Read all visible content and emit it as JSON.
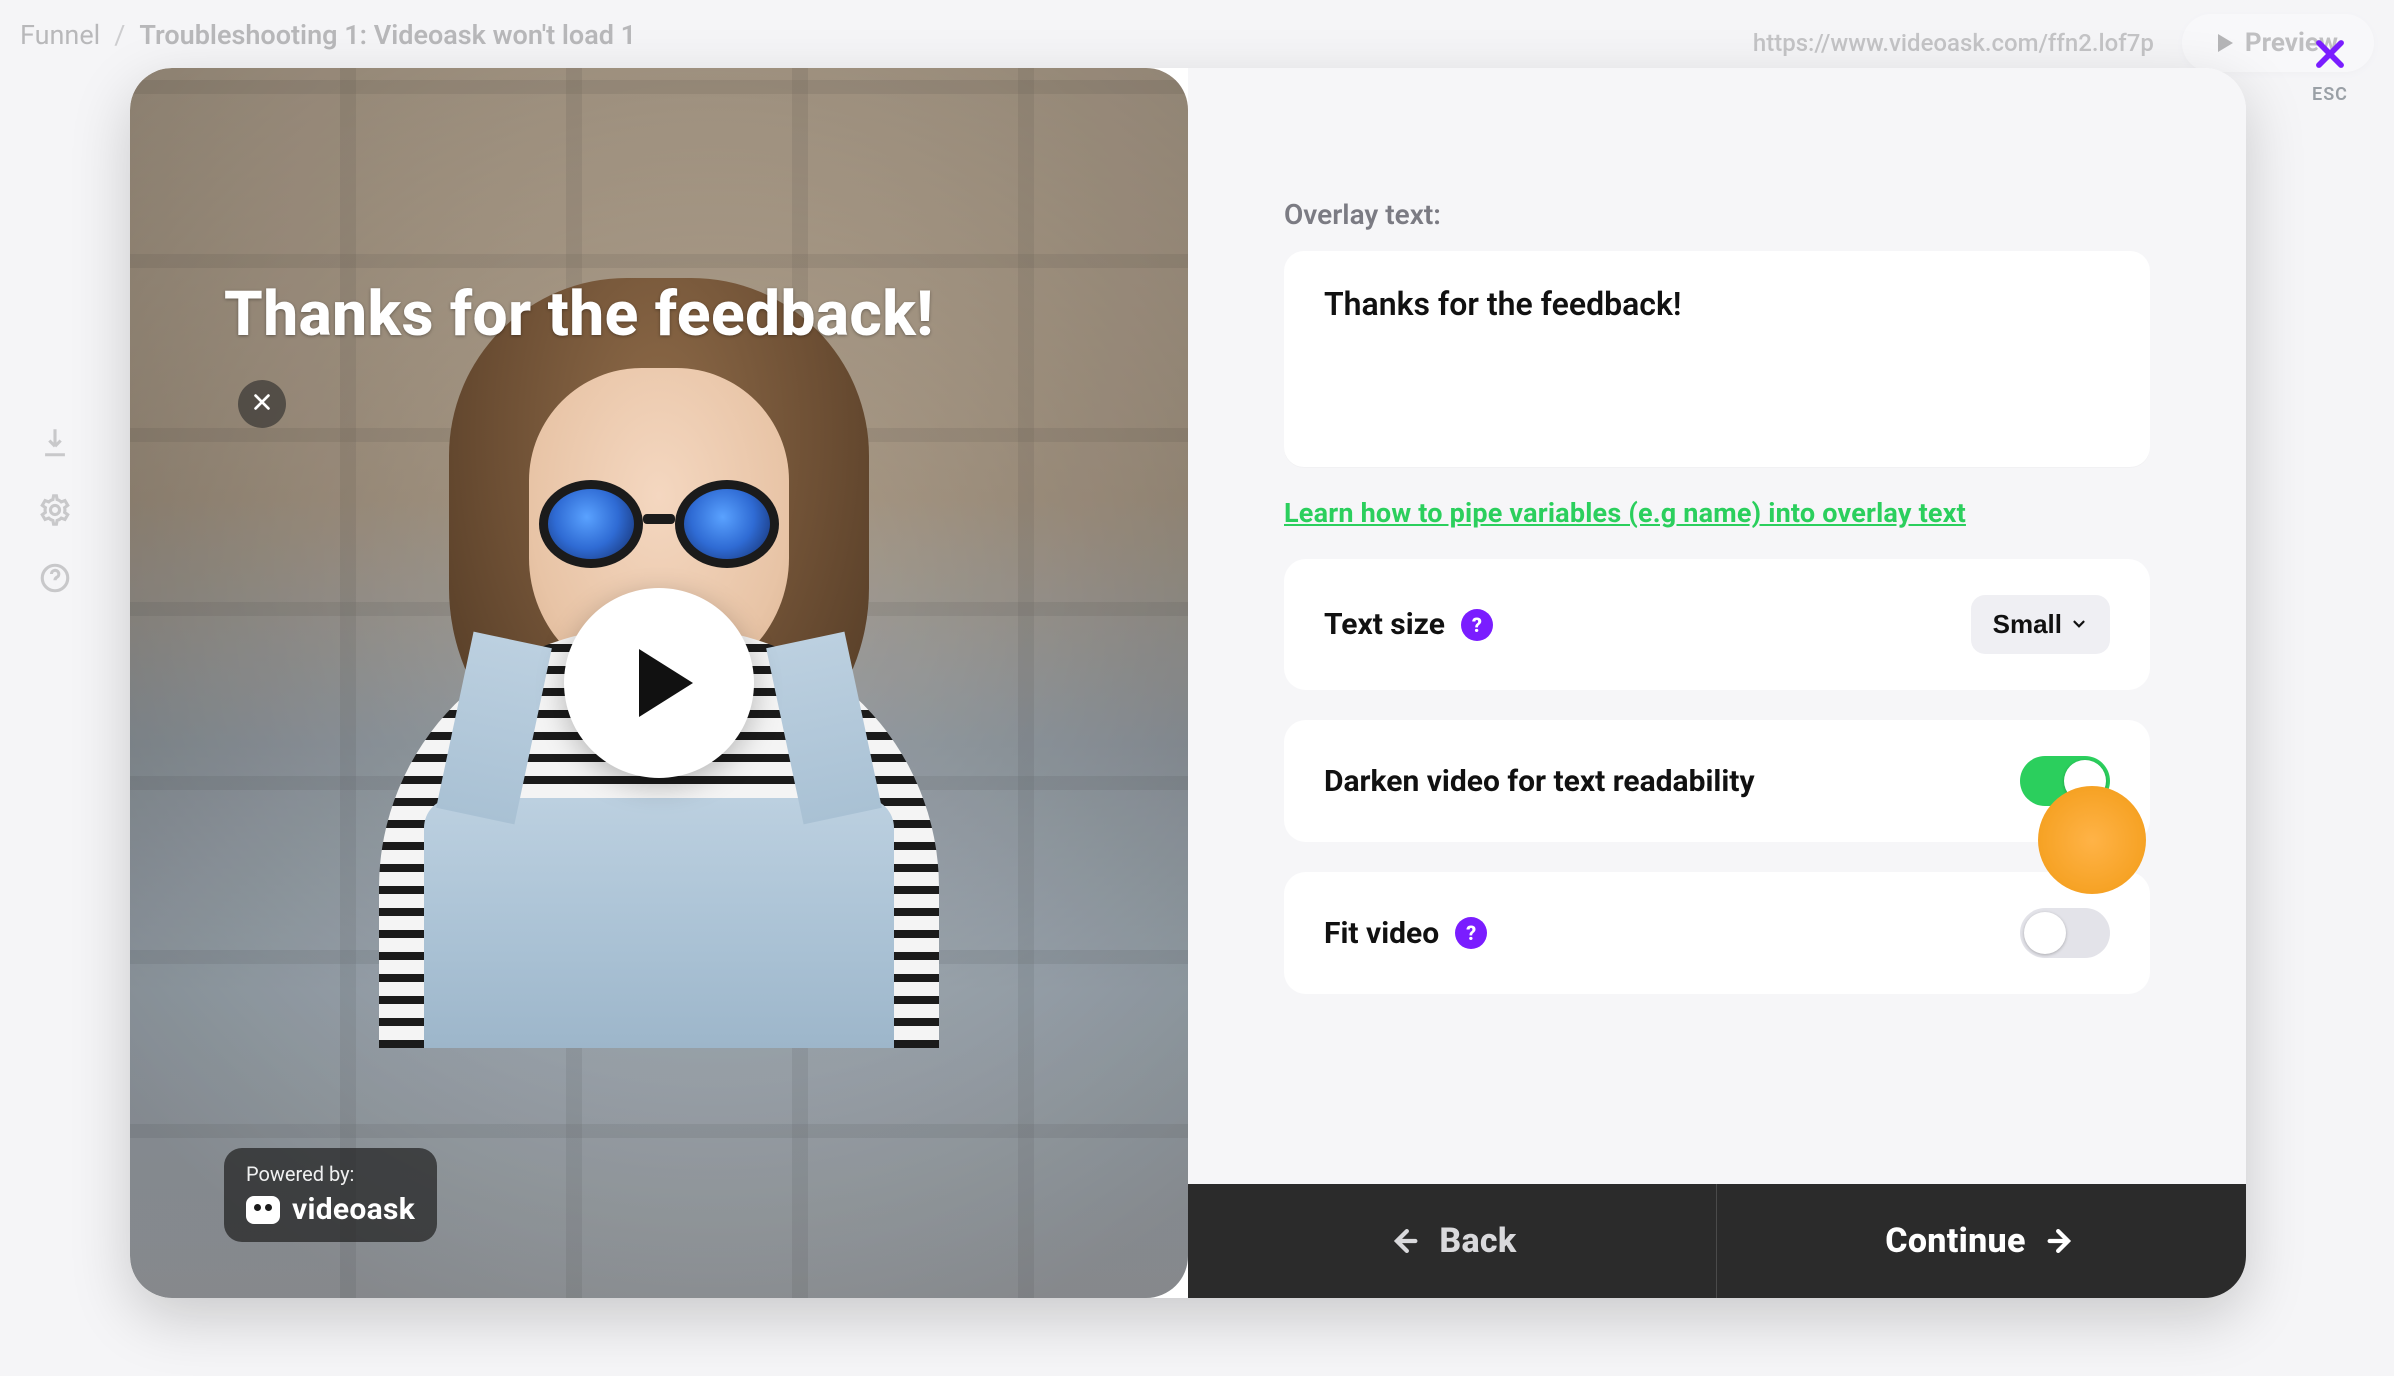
{
  "background": {
    "breadcrumb_root": "Funnel",
    "slash": "/",
    "title": "Troubleshooting 1: Videoask won't load 1",
    "url": "https://www.videoask.com/ffn2.lof7p",
    "preview_label": "Preview"
  },
  "close": {
    "esc_label": "ESC"
  },
  "preview": {
    "overlay_text": "Thanks for the feedback!",
    "powered_by_label": "Powered by:",
    "brand": "videoask"
  },
  "settings": {
    "overlay_label": "Overlay text:",
    "overlay_value": "Thanks for the feedback!",
    "learn_link": "Learn how to pipe variables (e.g name) into overlay text",
    "text_size": {
      "label": "Text size",
      "value": "Small"
    },
    "darken": {
      "label": "Darken video for text readability",
      "on": true
    },
    "fit": {
      "label": "Fit video",
      "on": false
    }
  },
  "footer": {
    "back": "Back",
    "continue": "Continue"
  },
  "help_glyph": "?"
}
